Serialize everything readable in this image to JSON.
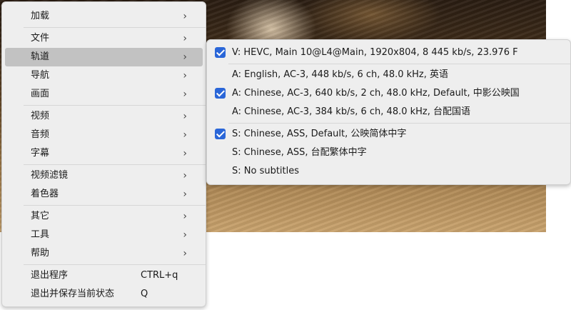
{
  "main_menu": {
    "items": [
      {
        "label": "加载",
        "has_submenu": true
      },
      {
        "label": "文件",
        "has_submenu": true
      },
      {
        "label": "轨道",
        "has_submenu": true,
        "active": true
      },
      {
        "label": "导航",
        "has_submenu": true
      },
      {
        "label": "画面",
        "has_submenu": true
      },
      {
        "label": "视频",
        "has_submenu": true
      },
      {
        "label": "音频",
        "has_submenu": true
      },
      {
        "label": "字幕",
        "has_submenu": true
      },
      {
        "label": "视频滤镜",
        "has_submenu": true
      },
      {
        "label": "着色器",
        "has_submenu": true
      },
      {
        "label": "其它",
        "has_submenu": true
      },
      {
        "label": "工具",
        "has_submenu": true
      },
      {
        "label": "帮助",
        "has_submenu": true
      },
      {
        "label": "退出程序",
        "shortcut": "CTRL+q"
      },
      {
        "label": "退出并保存当前状态",
        "shortcut": "Q"
      }
    ],
    "arrow_glyph": "›"
  },
  "tracks_submenu": {
    "video": [
      {
        "label": "V: HEVC, Main 10@L4@Main, 1920x804, 8 445 kb/s, 23.976 F",
        "checked": true
      }
    ],
    "audio": [
      {
        "label": "A: English, AC-3, 448 kb/s, 6 ch, 48.0 kHz, 英语",
        "checked": false
      },
      {
        "label": "A: Chinese, AC-3, 640 kb/s, 2 ch, 48.0 kHz, Default, 中影公映国",
        "checked": true
      },
      {
        "label": "A: Chinese, AC-3, 384 kb/s, 6 ch, 48.0 kHz, 台配国语",
        "checked": false
      }
    ],
    "subtitles": [
      {
        "label": "S: Chinese, ASS, Default, 公映简体中字",
        "checked": true
      },
      {
        "label": "S: Chinese, ASS, 台配繁体中字",
        "checked": false
      },
      {
        "label": "S: No subtitles",
        "checked": false
      }
    ]
  },
  "colors": {
    "menu_bg": "#eeeeee",
    "active_item_bg": "#c2c2c2",
    "checkbox": "#2a66d8"
  }
}
